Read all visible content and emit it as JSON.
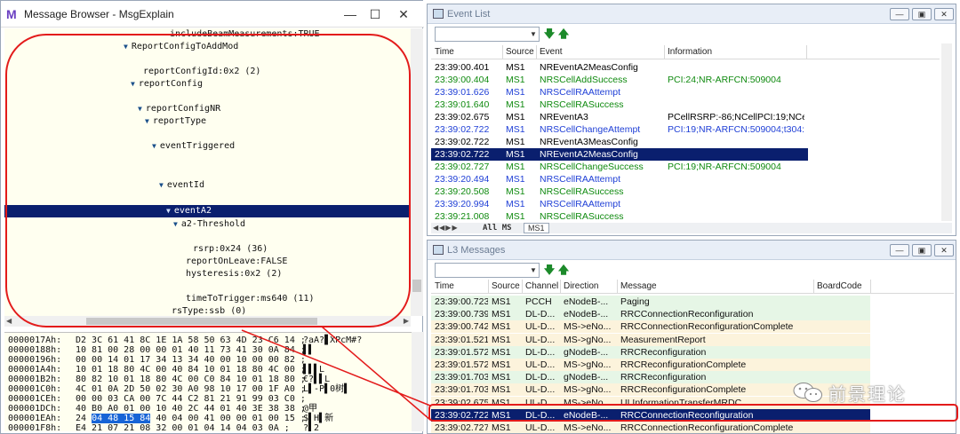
{
  "message_browser": {
    "title": "Message Browser - MsgExplain",
    "tree": [
      {
        "text": "includeBeamMeasurements:TRUE",
        "indent": 0,
        "arrow": false
      },
      {
        "text": "ReportConfigToAddMod",
        "indent": 1,
        "arrow": true
      },
      {
        "text": "reportConfigId:0x2 (2)",
        "indent": 2,
        "arrow": false
      },
      {
        "text": "reportConfig",
        "indent": 2,
        "arrow": true
      },
      {
        "text": "reportConfigNR",
        "indent": 3,
        "arrow": true
      },
      {
        "text": "reportType",
        "indent": 4,
        "arrow": true
      },
      {
        "text": "eventTriggered",
        "indent": 5,
        "arrow": true
      },
      {
        "text": "eventId",
        "indent": 6,
        "arrow": true
      },
      {
        "text": "eventA2",
        "indent": 7,
        "arrow": true,
        "selected": true
      },
      {
        "text": "a2-Threshold",
        "indent": 8,
        "arrow": true
      },
      {
        "text": "rsrp:0x24 (36)",
        "indent": 9,
        "arrow": false
      },
      {
        "text": "reportOnLeave:FALSE",
        "indent": 8,
        "arrow": false
      },
      {
        "text": "hysteresis:0x2 (2)",
        "indent": 8,
        "arrow": false
      },
      {
        "text": "timeToTrigger:ms640 (11)",
        "indent": 8,
        "arrow": false
      },
      {
        "text": "rsType:ssb (0)",
        "indent": 7,
        "arrow": false
      }
    ],
    "hex_rows": [
      {
        "addr": "0000017Ah:",
        "bytes": "D2 3C 61 41 8C 1E 1A 58 50 63 4D 23 C6 14 ;",
        "ascii": "?aA?▋XPcM#?"
      },
      {
        "addr": "00000188h:",
        "bytes": "10 81 00 28 00 00 01 40 11 73 41 30 0A 84 ;",
        "ascii": "▌▌"
      },
      {
        "addr": "00000196h:",
        "bytes": "00 00 14 01 17 34 13 34 40 00 10 00 00 82 ;",
        "ascii": ""
      },
      {
        "addr": "000001A4h:",
        "bytes": "10 01 18 80 4C 00 40 84 10 01 18 80 4C 00 ;",
        "ascii": "▌▌▌L"
      },
      {
        "addr": "000001B2h:",
        "bytes": "80 82 10 01 18 80 4C 00 C0 84 10 01 18 80 ;",
        "ascii": "€?▌▌L"
      },
      {
        "addr": "000001C0h:",
        "bytes": "4C 01 0A 2D 50 02 30 A0 98 10 17 00 1F A0 ;",
        "ascii": "L▌-P▌0树▌"
      },
      {
        "addr": "000001CEh:",
        "bytes": "00 00 03 CA 00 7C 44 C2 81 21 91 99 03 C0 ;",
        "ascii": ""
      },
      {
        "addr": "000001DCh:",
        "bytes": "40 B0 A0 01 00 10 40 2C 44 01 40 3E 38 38 ;",
        "ascii": "@甲"
      },
      {
        "addr": "000001EAh:",
        "bytes": "24 04 48 15 84 40 04 00 41 00 00 01 00 15 ;",
        "ascii": "$▌H▌新"
      },
      {
        "addr": "000001F8h:",
        "bytes": "E4 21 07 21 08 32 00 01 04 14 04 03 0A ;",
        "ascii": "?▌2"
      }
    ]
  },
  "event_list": {
    "title": "Event List",
    "columns": [
      "Time",
      "Source",
      "Event",
      "Information"
    ],
    "rows": [
      {
        "time": "23:39:00.401",
        "source": "MS1",
        "event": "NREventA2MeasConfig",
        "info": "",
        "color": "#000000"
      },
      {
        "time": "23:39:00.404",
        "source": "MS1",
        "event": "NRSCellAddSuccess",
        "info": "PCI:24;NR-ARFCN:509004",
        "color": "#0f8a0f"
      },
      {
        "time": "23:39:01.626",
        "source": "MS1",
        "event": "NRSCellRAAttempt",
        "info": "",
        "color": "#1f3fd6"
      },
      {
        "time": "23:39:01.640",
        "source": "MS1",
        "event": "NRSCellRASuccess",
        "info": "",
        "color": "#0f8a0f"
      },
      {
        "time": "23:39:02.675",
        "source": "MS1",
        "event": "NREventA3",
        "info": "PCellRSRP:-86;NCellPCI:19;NCe...",
        "color": "#000000"
      },
      {
        "time": "23:39:02.722",
        "source": "MS1",
        "event": "NRSCellChangeAttempt",
        "info": "PCI:19;NR-ARFCN:509004;t304:...",
        "color": "#1f3fd6"
      },
      {
        "time": "23:39:02.722",
        "source": "MS1",
        "event": "NREventA3MeasConfig",
        "info": "",
        "color": "#000000"
      },
      {
        "time": "23:39:02.722",
        "source": "MS1",
        "event": "NREventA2MeasConfig",
        "info": "",
        "color": "#ffffff",
        "selected": true
      },
      {
        "time": "23:39:02.727",
        "source": "MS1",
        "event": "NRSCellChangeSuccess",
        "info": "PCI:19;NR-ARFCN:509004",
        "color": "#0f8a0f"
      },
      {
        "time": "23:39:20.494",
        "source": "MS1",
        "event": "NRSCellRAAttempt",
        "info": "",
        "color": "#1f3fd6"
      },
      {
        "time": "23:39:20.508",
        "source": "MS1",
        "event": "NRSCellRASuccess",
        "info": "",
        "color": "#0f8a0f"
      },
      {
        "time": "23:39:20.994",
        "source": "MS1",
        "event": "NRSCellRAAttempt",
        "info": "",
        "color": "#1f3fd6"
      },
      {
        "time": "23:39:21.008",
        "source": "MS1",
        "event": "NRSCellRASuccess",
        "info": "",
        "color": "#0f8a0f"
      }
    ],
    "tabs": {
      "all": "All",
      "ms": "MS",
      "ms1": "MS1"
    }
  },
  "l3_messages": {
    "title": "L3 Messages",
    "columns": [
      "Time",
      "Source",
      "Channel",
      "Direction",
      "Message",
      "BoardCode"
    ],
    "rows": [
      {
        "time": "23:39:00.723",
        "source": "MS1",
        "channel": "PCCH",
        "direction": "eNodeB-...",
        "message": "Paging",
        "bg": "#e6f6e6"
      },
      {
        "time": "23:39:00.739",
        "source": "MS1",
        "channel": "DL-D...",
        "direction": "eNodeB-...",
        "message": "RRCConnectionReconfiguration",
        "bg": "#e6f6e6"
      },
      {
        "time": "23:39:00.742",
        "source": "MS1",
        "channel": "UL-D...",
        "direction": "MS->eNo...",
        "message": "RRCConnectionReconfigurationComplete",
        "bg": "#fcf3dc"
      },
      {
        "time": "23:39:01.521",
        "source": "MS1",
        "channel": "UL-D...",
        "direction": "MS->gNo...",
        "message": "MeasurementReport",
        "bg": "#fcf3dc"
      },
      {
        "time": "23:39:01.572",
        "source": "MS1",
        "channel": "DL-D...",
        "direction": "gNodeB-...",
        "message": "RRCReconfiguration",
        "bg": "#e6f6e6"
      },
      {
        "time": "23:39:01.572",
        "source": "MS1",
        "channel": "UL-D...",
        "direction": "MS->gNo...",
        "message": "RRCReconfigurationComplete",
        "bg": "#fcf3dc"
      },
      {
        "time": "23:39:01.703",
        "source": "MS1",
        "channel": "DL-D...",
        "direction": "gNodeB-...",
        "message": "RRCReconfiguration",
        "bg": "#e6f6e6"
      },
      {
        "time": "23:39:01.703",
        "source": "MS1",
        "channel": "UL-D...",
        "direction": "MS->gNo...",
        "message": "RRCReconfigurationComplete",
        "bg": "#fcf3dc"
      },
      {
        "time": "23:39:02.675",
        "source": "MS1",
        "channel": "UL-D...",
        "direction": "MS->eNo...",
        "message": "ULInformationTransferMRDC",
        "bg": "#fcf3dc"
      },
      {
        "time": "23:39:02.722",
        "source": "MS1",
        "channel": "DL-D...",
        "direction": "eNodeB-...",
        "message": "RRCConnectionReconfiguration",
        "bg": "#0a1f6e",
        "selected": true
      },
      {
        "time": "23:39:02.727",
        "source": "MS1",
        "channel": "UL-D...",
        "direction": "MS->eNo...",
        "message": "RRCConnectionReconfigurationComplete",
        "bg": "#fcf3dc"
      }
    ]
  },
  "watermark": {
    "text": "前景理论",
    "logo": "wechat-icon"
  },
  "colors": {
    "annotation_red": "#e31b1b",
    "selection_navy": "#0a1f6e"
  }
}
